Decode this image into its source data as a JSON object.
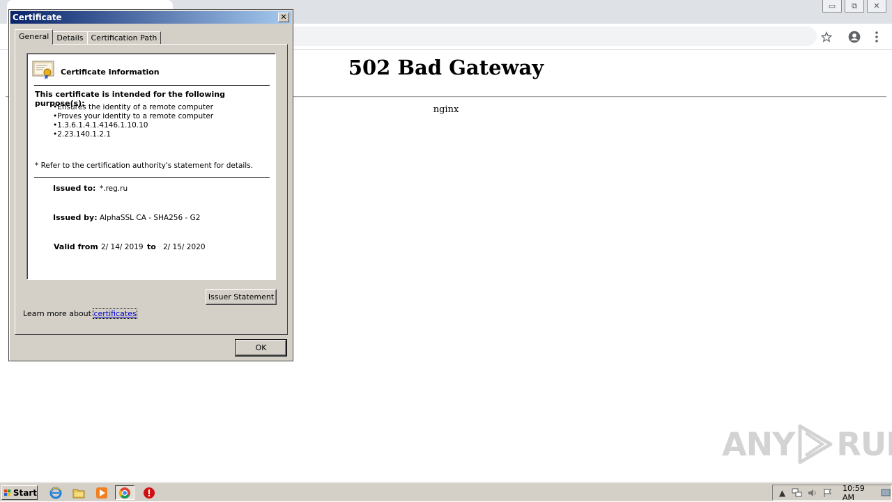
{
  "browser": {
    "window_buttons": {
      "minimize": "▭",
      "restore": "⧉",
      "close": "✕"
    },
    "icons": {
      "bookmark": "star-icon",
      "profile": "account-icon",
      "menu": "kebab-menu-icon"
    }
  },
  "page": {
    "heading": "502 Bad Gateway",
    "server": "nginx"
  },
  "dialog": {
    "title": "Certificate",
    "close_label": "✕",
    "tabs": [
      {
        "label": "General",
        "active": true
      },
      {
        "label": "Details",
        "active": false
      },
      {
        "label": "Certification Path",
        "active": false
      }
    ],
    "info_title": "Certificate Information",
    "purpose_heading": "This certificate is intended for the following purpose(s):",
    "purposes": [
      "Ensures the identity of a remote computer",
      "Proves your identity to a remote computer",
      "1.3.6.1.4.1.4146.1.10.10",
      "2.23.140.1.2.1"
    ],
    "refer_note": "* Refer to the certification authority's statement for details.",
    "issued_to_label": "Issued to:",
    "issued_to": "*.reg.ru",
    "issued_by_label": "Issued by:",
    "issued_by": "AlphaSSL CA - SHA256 - G2",
    "valid_from_label": "Valid from",
    "valid_from": "2/ 14/ 2019",
    "valid_to_label": "to",
    "valid_to": "2/ 15/ 2020",
    "issuer_statement_button": "Issuer Statement",
    "learn_more_prefix": "Learn more about ",
    "learn_more_link": "certificates",
    "ok_button": "OK"
  },
  "watermark": {
    "left": "ANY",
    "right": "RUN"
  },
  "taskbar": {
    "start_label": "Start",
    "apps": [
      "internet-explorer-icon",
      "file-explorer-icon",
      "media-player-icon",
      "chrome-icon",
      "stop-icon"
    ],
    "clock": "10:59 AM"
  },
  "colors": {
    "dialog_face": "#d4d0c8",
    "title_gradient_start": "#0a246a",
    "title_gradient_end": "#a6caf0",
    "link": "#0000cc"
  }
}
